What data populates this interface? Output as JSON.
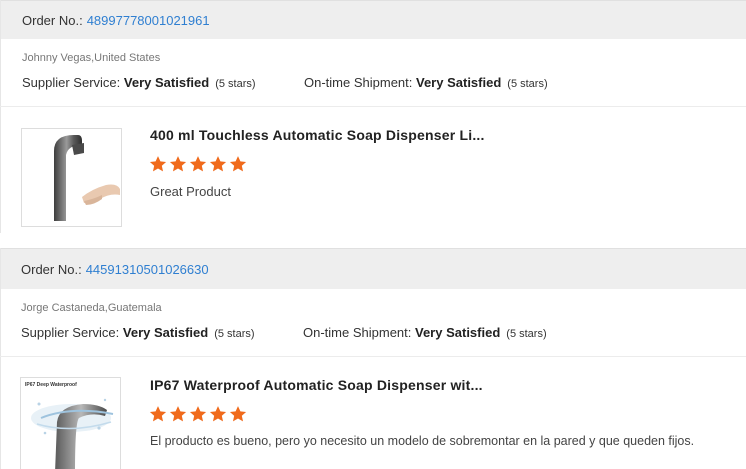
{
  "colors": {
    "link": "#2f7fd1",
    "star": "#f06a1b",
    "header_bg": "#eeeeee"
  },
  "orders": [
    {
      "order_label": "Order No.:",
      "order_number": "48997778001021961",
      "buyer": "Johnny Vegas,United States",
      "supplier_label": "Supplier Service:",
      "supplier_value": "Very Satisfied",
      "supplier_stars": "(5 stars)",
      "shipment_label": "On-time Shipment:",
      "shipment_value": "Very Satisfied",
      "shipment_stars": "(5 stars)",
      "product_name": "400 ml Touchless Automatic Soap Dispenser Li...",
      "rating": 5,
      "review": "Great Product",
      "thumb_icon": "soap-dispenser-image"
    },
    {
      "order_label": "Order No.:",
      "order_number": "44591310501026630",
      "buyer": "Jorge Castaneda,Guatemala",
      "supplier_label": "Supplier Service:",
      "supplier_value": "Very Satisfied",
      "supplier_stars": "(5 stars)",
      "shipment_label": "On-time Shipment:",
      "shipment_value": "Very Satisfied",
      "shipment_stars": "(5 stars)",
      "product_name": "IP67 Waterproof Automatic Soap Dispenser wit...",
      "rating": 5,
      "review": "El producto es bueno, pero yo necesito un modelo de sobremontar en la pared y que queden fijos.",
      "thumb_caption": "IP67 Deep Waterproof",
      "thumb_icon": "waterproof-dispenser-image"
    }
  ]
}
